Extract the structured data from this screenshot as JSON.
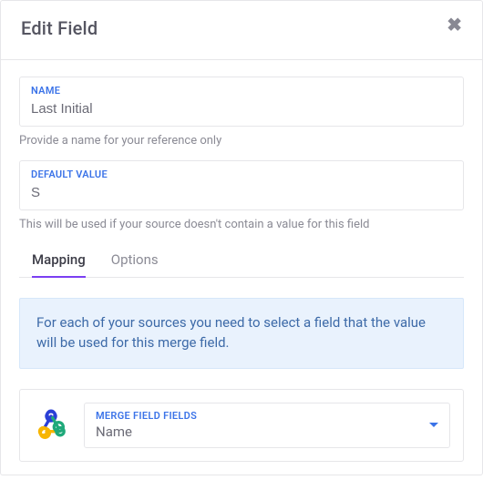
{
  "header": {
    "title": "Edit Field"
  },
  "fields": {
    "name": {
      "label": "NAME",
      "value": "Last Initial",
      "helper": "Provide a name for your reference only"
    },
    "default": {
      "label": "DEFAULT VALUE",
      "value": "S",
      "helper": "This will be used if your source doesn't contain a value for this field"
    }
  },
  "tabs": {
    "mapping": "Mapping",
    "options": "Options"
  },
  "mapping": {
    "banner": "For each of your sources you need to select a field that the value will be used for this merge field.",
    "source": {
      "dropdown_label": "MERGE FIELD FIELDS",
      "dropdown_value": "Name"
    }
  }
}
